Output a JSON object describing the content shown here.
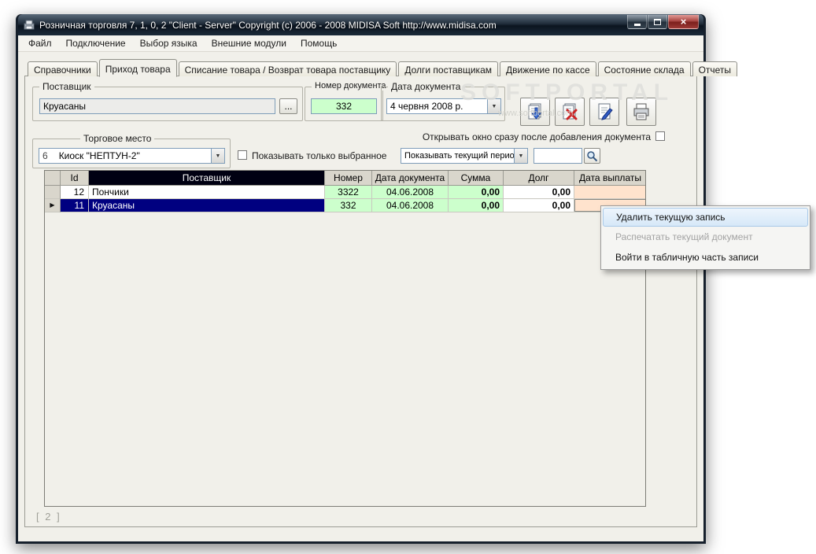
{
  "window": {
    "title": "Розничная торговля 7, 1, 0, 2 \"Client - Server\" Copyright (c) 2006 - 2008 MIDISA Soft http://www.midisa.com"
  },
  "icons": {
    "close": "×",
    "dropdown": "▼",
    "row_pointer": "▶"
  },
  "menu": {
    "items": [
      {
        "label": "Файл"
      },
      {
        "label": "Подключение"
      },
      {
        "label": "Выбор языка"
      },
      {
        "label": "Внешние модули"
      },
      {
        "label": "Помощь"
      }
    ]
  },
  "tabs": {
    "active": "Приход товара",
    "items": [
      {
        "label": "Справочники"
      },
      {
        "label": "Приход товара"
      },
      {
        "label": "Списание товара / Возврат товара поставщику"
      },
      {
        "label": "Долги поставщикам"
      },
      {
        "label": "Движение по кассе"
      },
      {
        "label": "Состояние склада"
      },
      {
        "label": "Отчеты"
      }
    ]
  },
  "form": {
    "supplier_label": "Поставщик",
    "supplier_value": "Круасаны",
    "browse_label": "...",
    "doc_number_label": "Номер документа",
    "doc_number_value": "332",
    "doc_date_label": "Дата документа",
    "doc_date_value": "4 червня 2008 р.",
    "trade_place_label": "Торговое место",
    "trade_place_prefix": "6",
    "trade_place_value": "Киоск \"НЕПТУН-2\"",
    "show_only_selected_label": "Показывать только выбранное",
    "open_after_add_label": "Открывать окно сразу после добавления документа",
    "period_value": "Показывать текущий период",
    "search_value": ""
  },
  "toolbar": {
    "buttons": [
      {
        "name": "post-document"
      },
      {
        "name": "delete-document"
      },
      {
        "name": "edit-document"
      },
      {
        "name": "print-document"
      }
    ]
  },
  "table": {
    "columns": [
      "",
      "Id",
      "Поставщик",
      "Номер",
      "Дата документа",
      "Сумма",
      "Долг",
      "Дата выплаты"
    ],
    "rows": [
      {
        "id": "12",
        "supplier": "Пончики",
        "number": "3322",
        "date": "04.06.2008",
        "sum": "0,00",
        "debt": "0,00",
        "payout": ""
      },
      {
        "id": "11",
        "supplier": "Круасаны",
        "number": "332",
        "date": "04.06.2008",
        "sum": "0,00",
        "debt": "0,00",
        "payout": ""
      }
    ]
  },
  "context_menu": {
    "items": [
      {
        "label": "Удалить текущую запись",
        "state": "highlighted"
      },
      {
        "label": "Распечатать текущий документ",
        "state": "disabled"
      },
      {
        "label": "Войти в табличную часть записи",
        "state": "normal"
      }
    ]
  },
  "status": {
    "record_count": "[ 2 ]"
  },
  "watermark": {
    "line1": "SOFTPORTAL",
    "line2": "www.softportal.com"
  }
}
